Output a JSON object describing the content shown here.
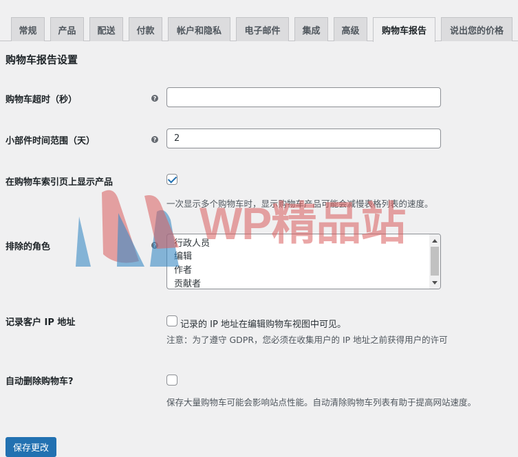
{
  "tabs": [
    {
      "label": "常规",
      "active": false
    },
    {
      "label": "产品",
      "active": false
    },
    {
      "label": "配送",
      "active": false
    },
    {
      "label": "付款",
      "active": false
    },
    {
      "label": "帐户和隐私",
      "active": false
    },
    {
      "label": "电子邮件",
      "active": false
    },
    {
      "label": "集成",
      "active": false
    },
    {
      "label": "高级",
      "active": false
    },
    {
      "label": "购物车报告",
      "active": true
    },
    {
      "label": "说出您的价格",
      "active": false
    }
  ],
  "section_title": "购物车报告设置",
  "help_glyph": "?",
  "fields": {
    "cart_timeout": {
      "label": "购物车超时（秒）",
      "value": "",
      "placeholder": ""
    },
    "widget_range": {
      "label": "小部件时间范围（天）",
      "value": "2"
    },
    "show_products": {
      "label": "在购物车索引页上显示产品",
      "checked": true,
      "description": "一次显示多个购物车时，显示购物车产品可能会减慢表格列表的速度。"
    },
    "excluded_roles": {
      "label": "排除的角色",
      "options": [
        "行政人员",
        "编辑",
        "作者",
        "贡献者"
      ]
    },
    "log_ip": {
      "label": "记录客户 IP 地址",
      "checked": false,
      "inline_label": "记录的 IP 地址在编辑购物车视图中可见。",
      "description": "注意：为了遵守 GDPR，您必须在收集用户的 IP 地址之前获得用户的许可"
    },
    "auto_delete": {
      "label": "自动删除购物车?",
      "checked": false,
      "description": "保存大量购物车可能会影响站点性能。自动清除购物车列表有助于提高网站速度。"
    }
  },
  "save_button": "保存更改",
  "watermark_text": "WP精品站",
  "colors": {
    "accent": "#2271b1",
    "watermark_red": "#d85c5c",
    "watermark_blue": "#3b8bc4"
  }
}
